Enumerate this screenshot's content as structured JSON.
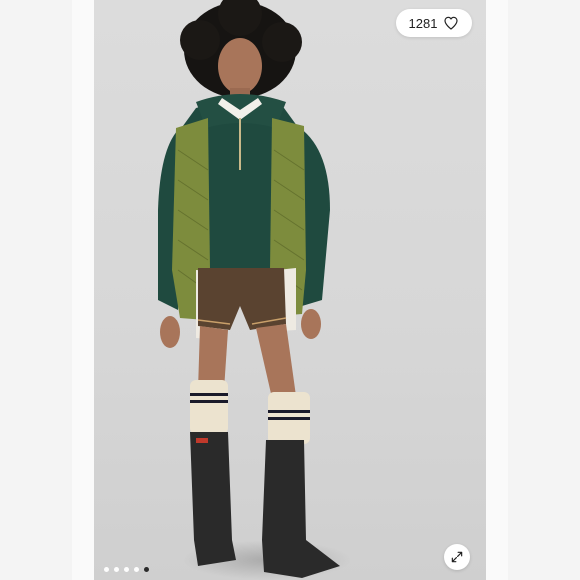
{
  "likes": {
    "count": "1281",
    "icon": "heart-icon"
  },
  "gallery": {
    "total_dots": 5,
    "active_dot": 5
  },
  "controls": {
    "expand_icon": "expand-icon"
  },
  "colors": {
    "fleece": "#1f4a3f",
    "vest": "#7d8c3d",
    "shorts": "#5a4330",
    "boots": "#2a2a2a",
    "socks": "#ece3cf",
    "sock_stripe": "#1a1a2a",
    "hair": "#161412",
    "skin": "#a8755a"
  }
}
